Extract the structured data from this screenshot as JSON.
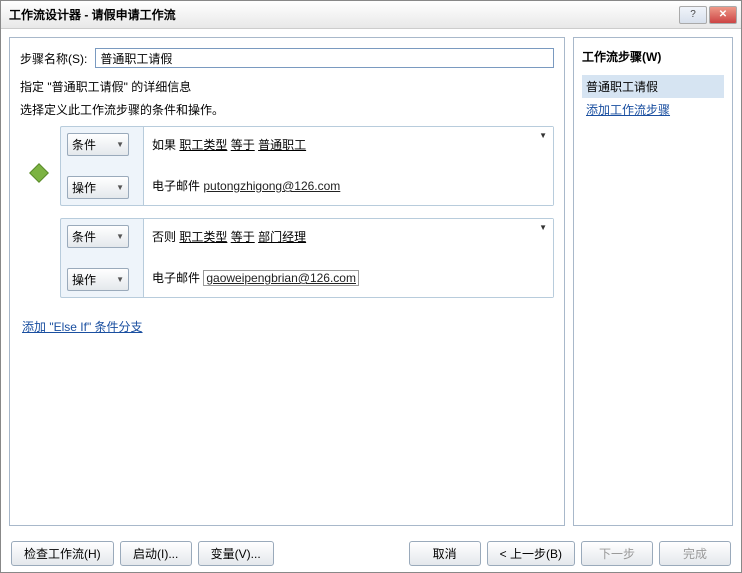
{
  "window": {
    "title": "工作流设计器 - 请假申请工作流",
    "help": "?",
    "close": "✕"
  },
  "main": {
    "step_name_label": "步骤名称(S):",
    "step_name_value": "普通职工请假",
    "desc": "指定 \"普通职工请假\" 的详细信息",
    "instr": "选择定义此工作流步骤的条件和操作。",
    "branches": [
      {
        "cond_btn": "条件",
        "act_btn": "操作",
        "cond_prefix": "如果",
        "cond_field": "职工类型",
        "cond_op": "等于",
        "cond_value": "普通职工",
        "email_label": "电子邮件",
        "email_value": "putongzhigong@126.com",
        "email_boxed": false
      },
      {
        "cond_btn": "条件",
        "act_btn": "操作",
        "cond_prefix": "否则",
        "cond_field": "职工类型",
        "cond_op": "等于",
        "cond_value": "部门经理",
        "email_label": "电子邮件",
        "email_value": "gaoweipengbrian@126.com",
        "email_boxed": true
      }
    ],
    "add_elseif": "添加 \"Else If\" 条件分支"
  },
  "sidebar": {
    "title": "工作流步骤(W)",
    "items": [
      {
        "label": "普通职工请假",
        "selected": true
      }
    ],
    "add_link": "添加工作流步骤"
  },
  "footer": {
    "check": "检查工作流(H)",
    "start": "启动(I)...",
    "vars": "变量(V)...",
    "cancel": "取消",
    "prev": "< 上一步(B)",
    "next": "下一步",
    "finish": "完成"
  }
}
